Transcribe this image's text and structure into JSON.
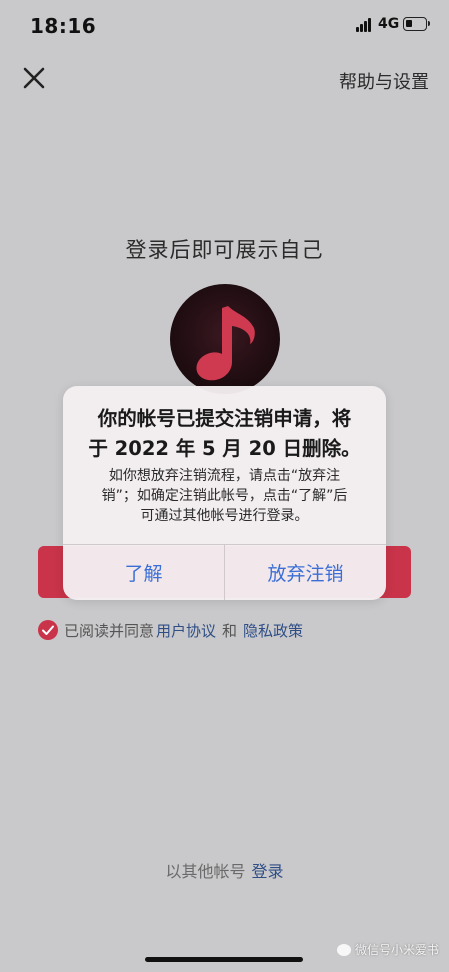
{
  "status_bar": {
    "time": "18:16",
    "network": "4G"
  },
  "header": {
    "close_icon": "close-icon",
    "help_label": "帮助与设置"
  },
  "main": {
    "title": "登录后即可展示自己",
    "logo_icon": "music-note-icon"
  },
  "agreement": {
    "prefix": "已阅读并同意",
    "user_agreement": "用户协议",
    "and": "和",
    "privacy_policy": "隐私政策"
  },
  "other_login": {
    "text": "以其他帐号",
    "link": "登录"
  },
  "dialog": {
    "title": "你的帐号已提交注销申请，将\n于 2022 年 5 月 20 日删除。",
    "message": "如你想放弃注销流程，请点击“放弃注\n销”；如确定注销此帐号，点击“了解”后\n可通过其他帐号进行登录。",
    "ok_label": "了解",
    "abandon_label": "放弃注销"
  },
  "watermark": {
    "text": "微信号小米爱书"
  },
  "colors": {
    "brand_red": "#c9344a",
    "link_blue": "#2f4e86",
    "dialog_button_blue": "#3b6fd6"
  }
}
